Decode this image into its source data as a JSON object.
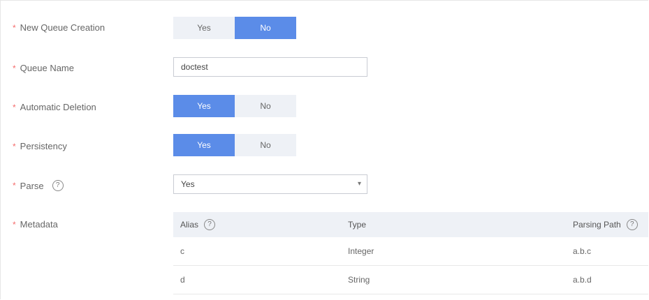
{
  "form": {
    "new_queue": {
      "label": "New Queue Creation",
      "options": [
        "Yes",
        "No"
      ],
      "selected": "No"
    },
    "queue_name": {
      "label": "Queue Name",
      "value": "doctest"
    },
    "auto_delete": {
      "label": "Automatic Deletion",
      "options": [
        "Yes",
        "No"
      ],
      "selected": "Yes"
    },
    "persistency": {
      "label": "Persistency",
      "options": [
        "Yes",
        "No"
      ],
      "selected": "Yes"
    },
    "parse": {
      "label": "Parse",
      "value": "Yes"
    },
    "metadata": {
      "label": "Metadata"
    }
  },
  "metadata_table": {
    "headers": [
      "Alias",
      "Type",
      "Parsing Path"
    ],
    "rows": [
      [
        "c",
        "Integer",
        "a.b.c"
      ],
      [
        "d",
        "String",
        "a.b.d"
      ]
    ]
  },
  "colors": {
    "accent": "#5b8ce8",
    "segment_bg": "#eef1f6",
    "required": "#f56c6c"
  }
}
